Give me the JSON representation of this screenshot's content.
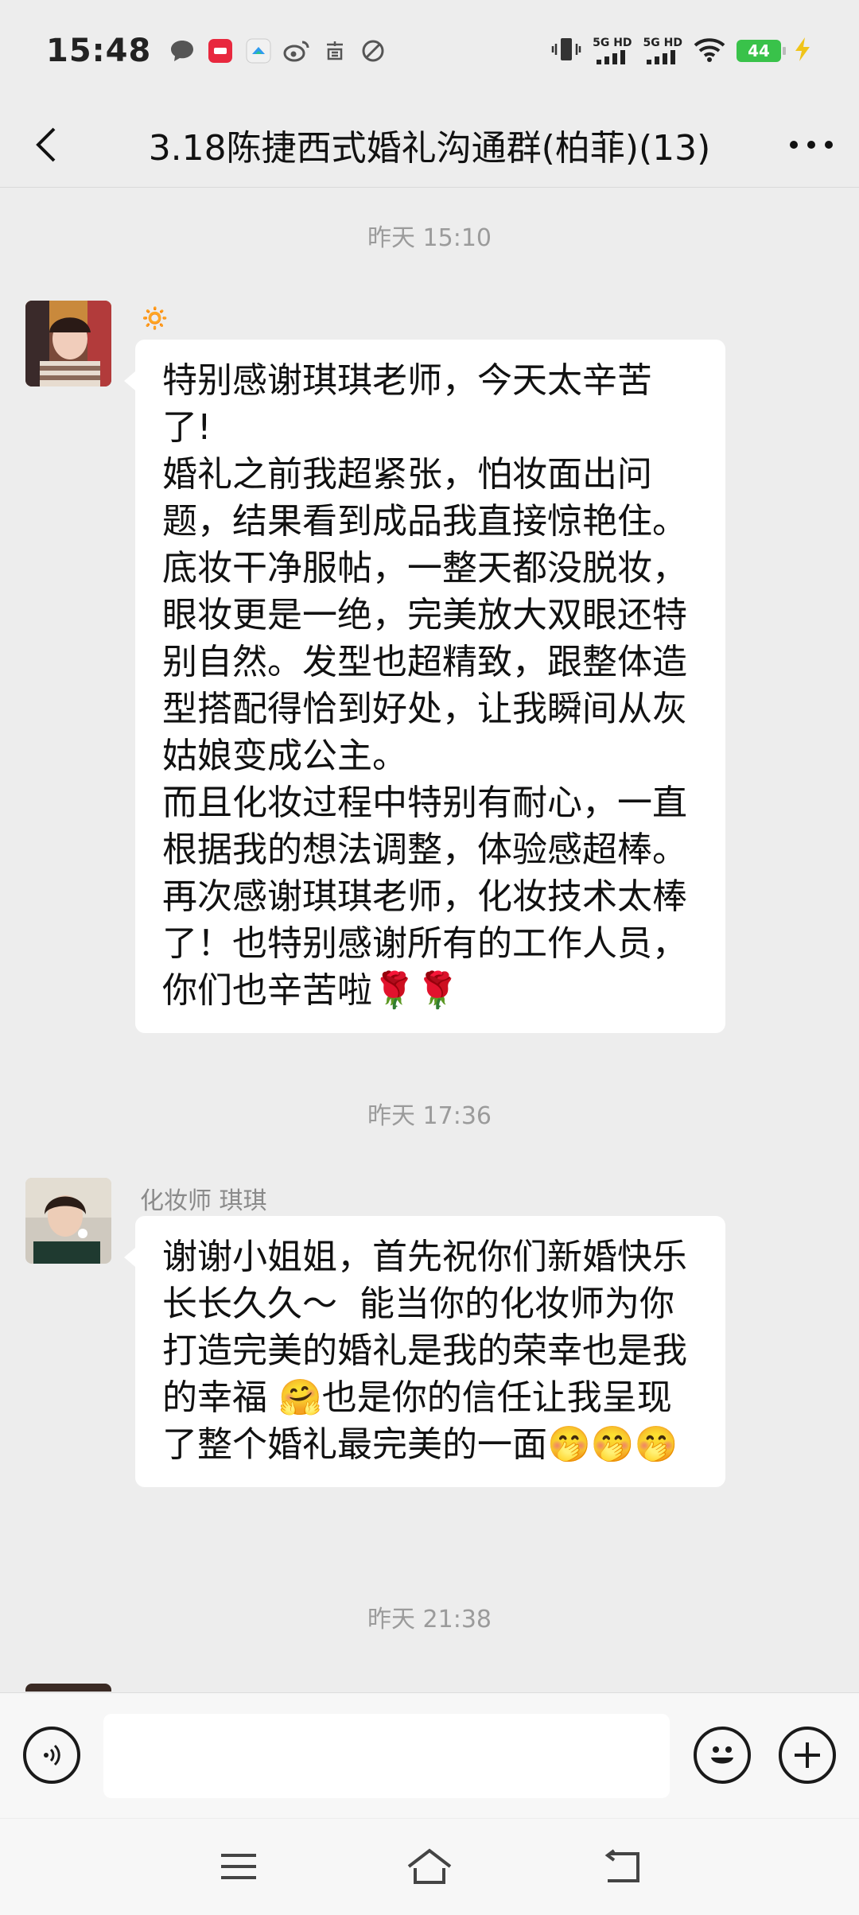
{
  "status_bar": {
    "time": "15:48",
    "network_1": "5G HD",
    "network_2": "5G HD",
    "battery": "44"
  },
  "header": {
    "title": "3.18陈捷西式婚礼沟通群(柏菲)(13)"
  },
  "messages": [
    {
      "timestamp": "昨天 15:10",
      "sender": "🔅",
      "text": "特别感谢琪琪老师，今天太辛苦了!\n婚礼之前我超紧张，怕妆面出问题，结果看到成品我直接惊艳住。底妆干净服帖，一整天都没脱妆，眼妆更是一绝，完美放大双眼还特别自然。发型也超精致，跟整体造型搭配得恰到好处，让我瞬间从灰姑娘变成公主。\n而且化妆过程中特别有耐心，一直根据我的想法调整，体验感超棒。再次感谢琪琪老师，化妆技术太棒了！也特别感谢所有的工作人员，你们也辛苦啦🌹🌹"
    },
    {
      "timestamp": "昨天 17:36",
      "sender": "化妆师  琪琪",
      "text": "谢谢小姐姐，首先祝你们新婚快乐 长长久久～  能当你的化妆师为你打造完美的婚礼是我的荣幸也是我的幸福 🤗也是你的信任让我呈现了整个婚礼最完美的一面🤭🤭🤭"
    },
    {
      "timestamp": "昨天 21:38"
    }
  ],
  "input_bar": {
    "placeholder": ""
  },
  "colors": {
    "background": "#ededed",
    "bubble": "#ffffff",
    "battery": "#39c24a"
  }
}
